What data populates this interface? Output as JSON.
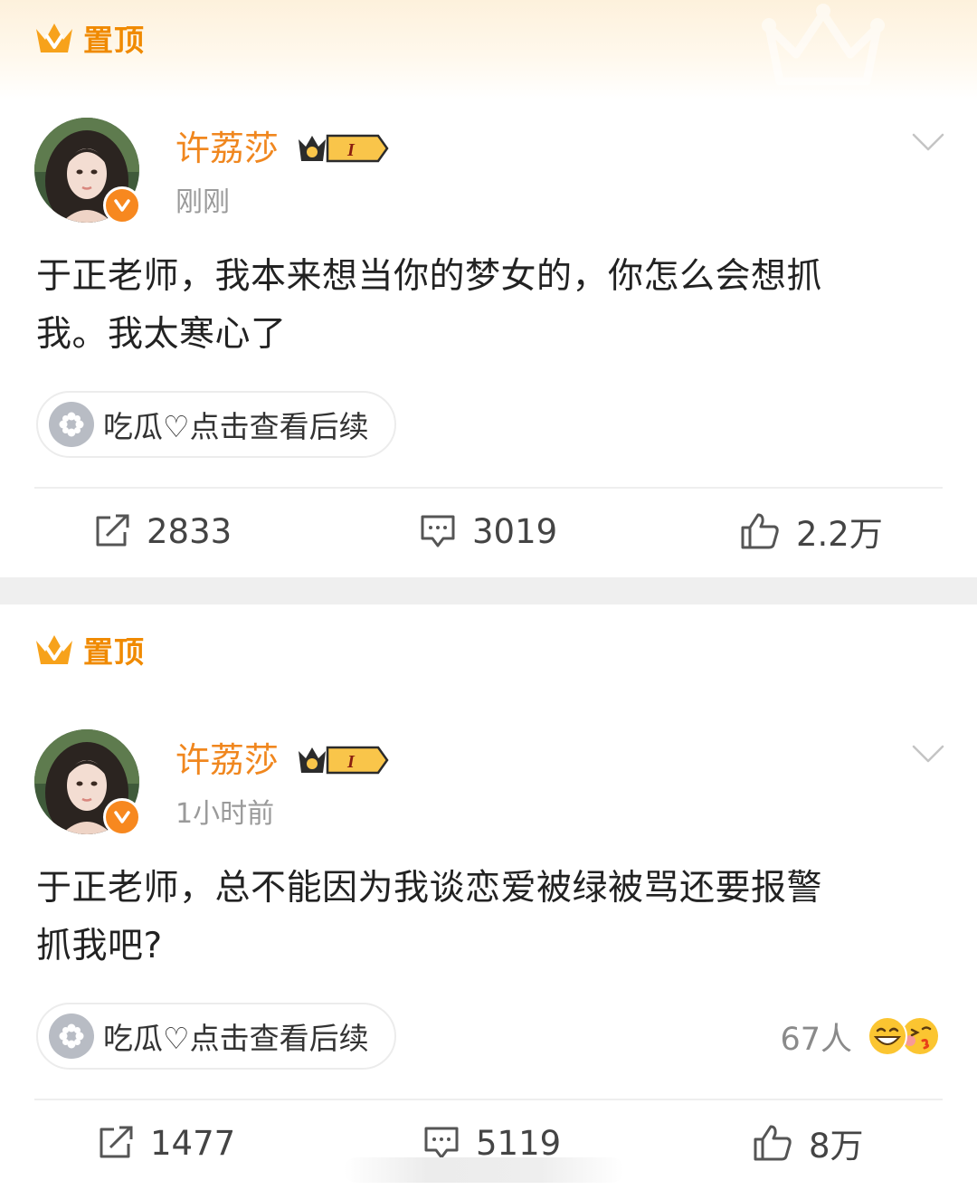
{
  "colors": {
    "accent_orange": "#f0871f",
    "pinned_orange": "#f08a00",
    "text": "#222222",
    "muted": "#9a9a9a",
    "divider": "#efefef"
  },
  "posts": [
    {
      "pinned_label": "置顶",
      "username": "许荔莎",
      "member_badge_text": "I",
      "time": "刚刚",
      "text_line1": "于正老师，我本来想当你的梦女的，你怎么会想抓",
      "text_line2": "我。我太寒心了",
      "topic_chip": "吃瓜♡点击查看后续",
      "reposts": "2833",
      "comments": "3019",
      "likes": "2.2万",
      "icons": [
        "crown-icon",
        "verified-v-icon",
        "chevron-down-icon",
        "flower-icon",
        "repost-icon",
        "comment-icon",
        "thumbs-up-icon"
      ]
    },
    {
      "pinned_label": "置顶",
      "username": "许荔莎",
      "member_badge_text": "I",
      "time": "1小时前",
      "text_line1": "于正老师，总不能因为我谈恋爱被绿被骂还要报警",
      "text_line2": "抓我吧?",
      "topic_chip": "吃瓜♡点击查看后续",
      "reaction_count": "67人",
      "reposts": "1477",
      "comments": "5119",
      "likes": "8万",
      "icons": [
        "laugh-emoji-icon",
        "kiss-emoji-icon"
      ]
    }
  ]
}
